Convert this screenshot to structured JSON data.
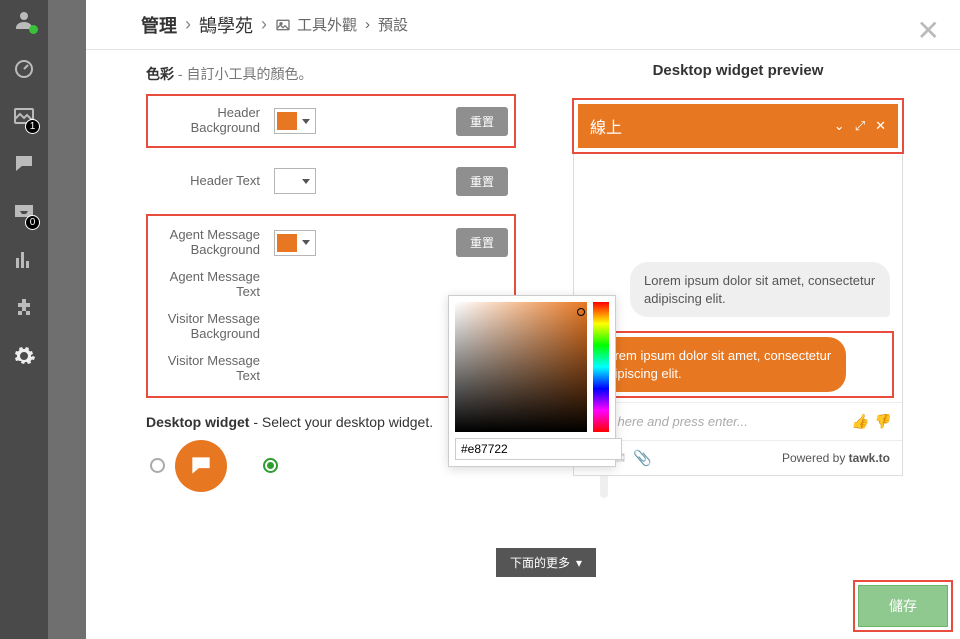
{
  "breadcrumb": {
    "l1": "管理",
    "l2": "鵠學苑",
    "l3": "工具外觀",
    "l4": "預設"
  },
  "badges": {
    "images": "1",
    "inbox": "0"
  },
  "section_color": {
    "title": "色彩",
    "desc": " - 自訂小工具的顏色。"
  },
  "rows": {
    "header_bg": {
      "label": "Header Background",
      "color": "#e87722",
      "reset": "重置"
    },
    "header_text": {
      "label": "Header Text",
      "color": "#ffffff",
      "reset": "重置"
    },
    "agent_bg": {
      "label": "Agent Message Background",
      "color": "#e87722",
      "reset": "重置"
    },
    "agent_text": {
      "label": "Agent Message Text"
    },
    "visitor_bg": {
      "label": "Visitor Message Background"
    },
    "visitor_text": {
      "label": "Visitor Message Text"
    }
  },
  "picker": {
    "hex": "#e87722"
  },
  "desktop_widget": {
    "title": "Desktop widget",
    "desc": " - Select your desktop widget."
  },
  "more": "下面的更多",
  "preview": {
    "title": "Desktop widget preview",
    "header": "線上",
    "visitor_msg": "Lorem ipsum dolor sit amet, consectetur adipiscing elit.",
    "agent_msg": "Lorem ipsum dolor sit amet, consectetur adipiscing elit.",
    "placeholder": "Type here and press enter...",
    "powered_pre": "Powered by ",
    "powered_brand": "tawk.to"
  },
  "save": "儲存"
}
